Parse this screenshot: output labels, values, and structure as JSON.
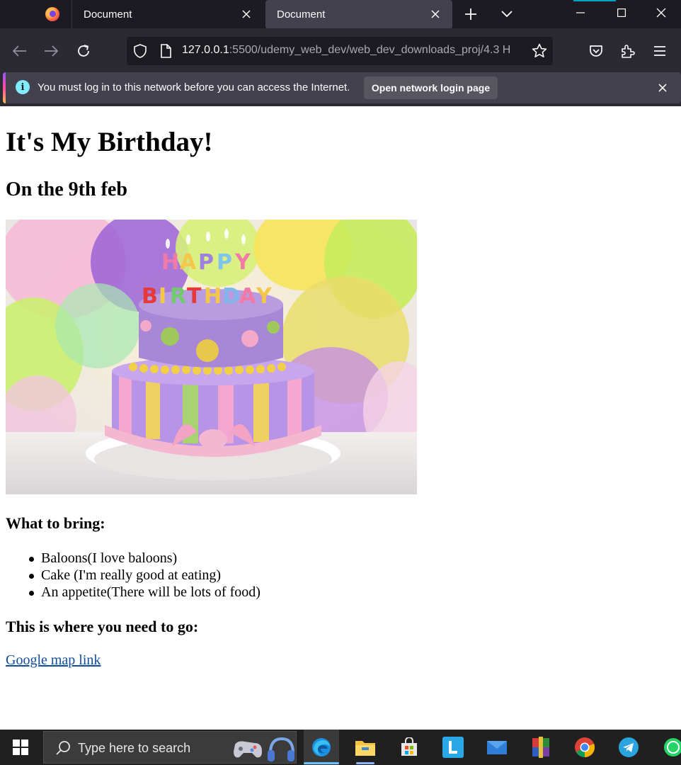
{
  "browser": {
    "tabs": [
      {
        "title": "Document",
        "active": false
      },
      {
        "title": "Document",
        "active": true
      }
    ],
    "url": {
      "host": "127.0.0.1",
      "path": ":5500/udemy_web_dev/web_dev_downloads_proj/4.3 H"
    },
    "notification": {
      "message": "You must log in to this network before you can access the Internet.",
      "button_label": "Open network login page"
    }
  },
  "page": {
    "title": "It's My Birthday!",
    "subtitle": "On the 9th feb",
    "bring_heading": "What to bring:",
    "bring_items": [
      "Baloons(I love baloons)",
      "Cake (I'm really good at eating)",
      "An appetite(There will be lots of food)"
    ],
    "go_heading": "This is where you need to go:",
    "map_link": "Google map link"
  },
  "taskbar": {
    "search_placeholder": "Type here to search",
    "apps": [
      "edge-icon",
      "file-explorer-icon",
      "microsoft-store-icon",
      "l-app-icon",
      "mail-icon",
      "winrar-icon",
      "chrome-icon",
      "telegram-icon",
      "whatsapp-icon"
    ]
  },
  "colors": {
    "tabstrip_bg": "#1c1b22",
    "toolbar_bg": "#2b2a33",
    "active_tab_bg": "#42414d",
    "link": "#0f4c9e",
    "taskbar_bg": "#202020"
  }
}
